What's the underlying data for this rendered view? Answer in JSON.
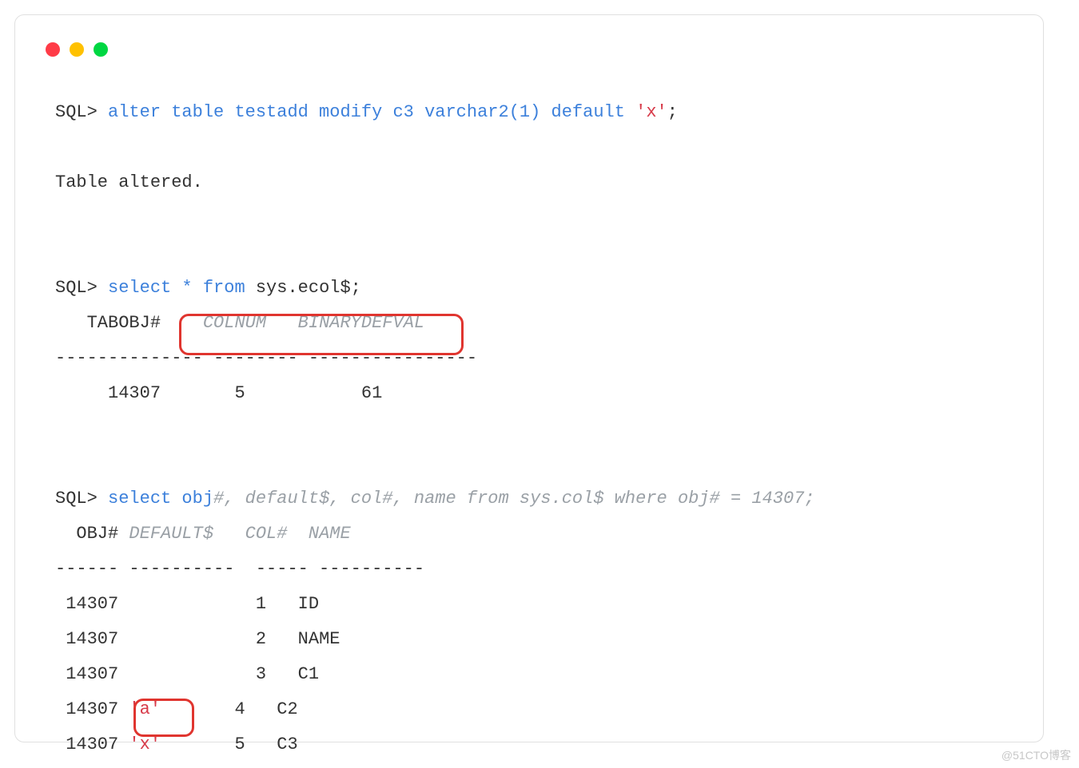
{
  "sql": {
    "prompt": "SQL>",
    "cmd1_pre": " alter table testadd modify c3 varchar2(1) default ",
    "cmd1_str": "'x'",
    "cmd1_post": ";",
    "msg1": "Table altered.",
    "cmd2_pre": " select * ",
    "cmd2_from_kw": "from",
    "cmd2_from_rest": " sys.ecol$;",
    "ecol_headers": {
      "tabobj": "   TABOBJ#    ",
      "colnum": "COLNUM   ",
      "binarydefval": "BINARYDEFVAL"
    },
    "ecol_divider": "-------------- -------- ----------------",
    "ecol_row": {
      "tabobj": "     14307",
      "colnum": "       5",
      "binarydefval": "           61"
    },
    "cmd3_pre": " select obj",
    "cmd3_comment": "#, default$, col#, name from sys.col$ where obj# = 14307;",
    "col_headers": {
      "obj": "  OBJ#",
      "default": " DEFAULT$   ",
      "col": "COL#  ",
      "name": "NAME"
    },
    "col_divider": "------ ----------  ----- ----------",
    "col_rows": [
      {
        "obj": " 14307",
        "default": "           ",
        "col": "  1   ",
        "name": "ID"
      },
      {
        "obj": " 14307",
        "default": "           ",
        "col": "  2   ",
        "name": "NAME"
      },
      {
        "obj": " 14307",
        "default": "           ",
        "col": "  3   ",
        "name": "C1"
      },
      {
        "obj": " 14307",
        "default": " ",
        "default_str": "'a'",
        "default_pad": "      ",
        "col": " 4   ",
        "name": "C2"
      },
      {
        "obj": " 14307",
        "default": " ",
        "default_str": "'x'",
        "default_pad": "      ",
        "col": " 5   ",
        "name": "C3"
      }
    ]
  },
  "watermark": "@51CTO博客"
}
